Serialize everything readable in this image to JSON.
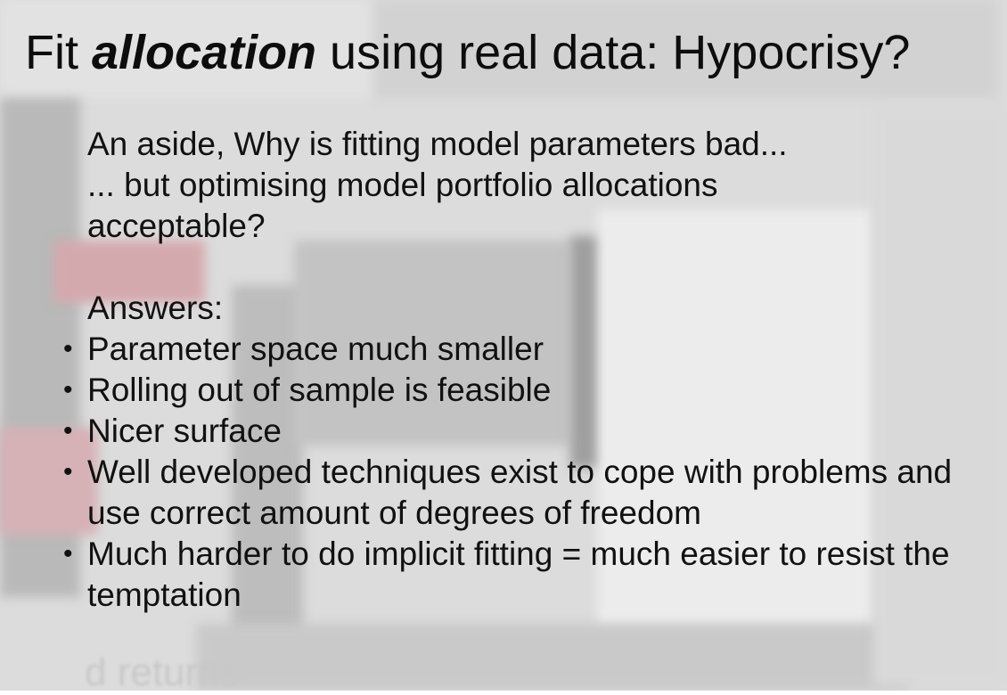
{
  "slide": {
    "title_pre": "Fit ",
    "title_em": "allocation",
    "title_post": " using real data: Hypocrisy?",
    "intro_lines": [
      "An aside, Why is fitting model parameters bad...",
      "... but optimising model portfolio allocations",
      "acceptable?"
    ],
    "answers_label": "Answers:",
    "bullets": [
      "Parameter space much smaller",
      "Rolling out of sample is feasible",
      "Nicer surface",
      "Well developed techniques exist to cope with problems and use correct amount of degrees of freedom",
      "Much harder to do implicit fitting = much easier to resist the temptation"
    ],
    "bullet_glyph": "•"
  },
  "background": {
    "partial_text": "d returns"
  }
}
